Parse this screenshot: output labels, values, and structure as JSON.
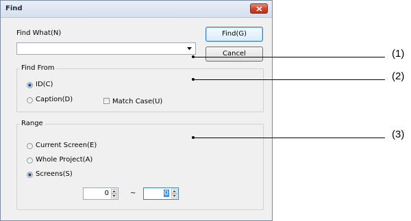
{
  "window": {
    "title": "Find"
  },
  "find_what": {
    "label": "Find What(N)",
    "value": ""
  },
  "buttons": {
    "find": "Find(G)",
    "cancel": "Cancel"
  },
  "find_from": {
    "title": "Find From",
    "options": [
      "ID(C)",
      "Caption(D)"
    ],
    "selected": "ID(C)",
    "match_case": "Match Case(U)"
  },
  "range": {
    "title": "Range",
    "options": [
      "Current Screen(E)",
      "Whole Project(A)",
      "Screens(S)"
    ],
    "selected": "Screens(S)",
    "from_value": "0",
    "tilde": "~",
    "to_value": "0"
  },
  "callouts": [
    "(1)",
    "(2)",
    "(3)"
  ]
}
